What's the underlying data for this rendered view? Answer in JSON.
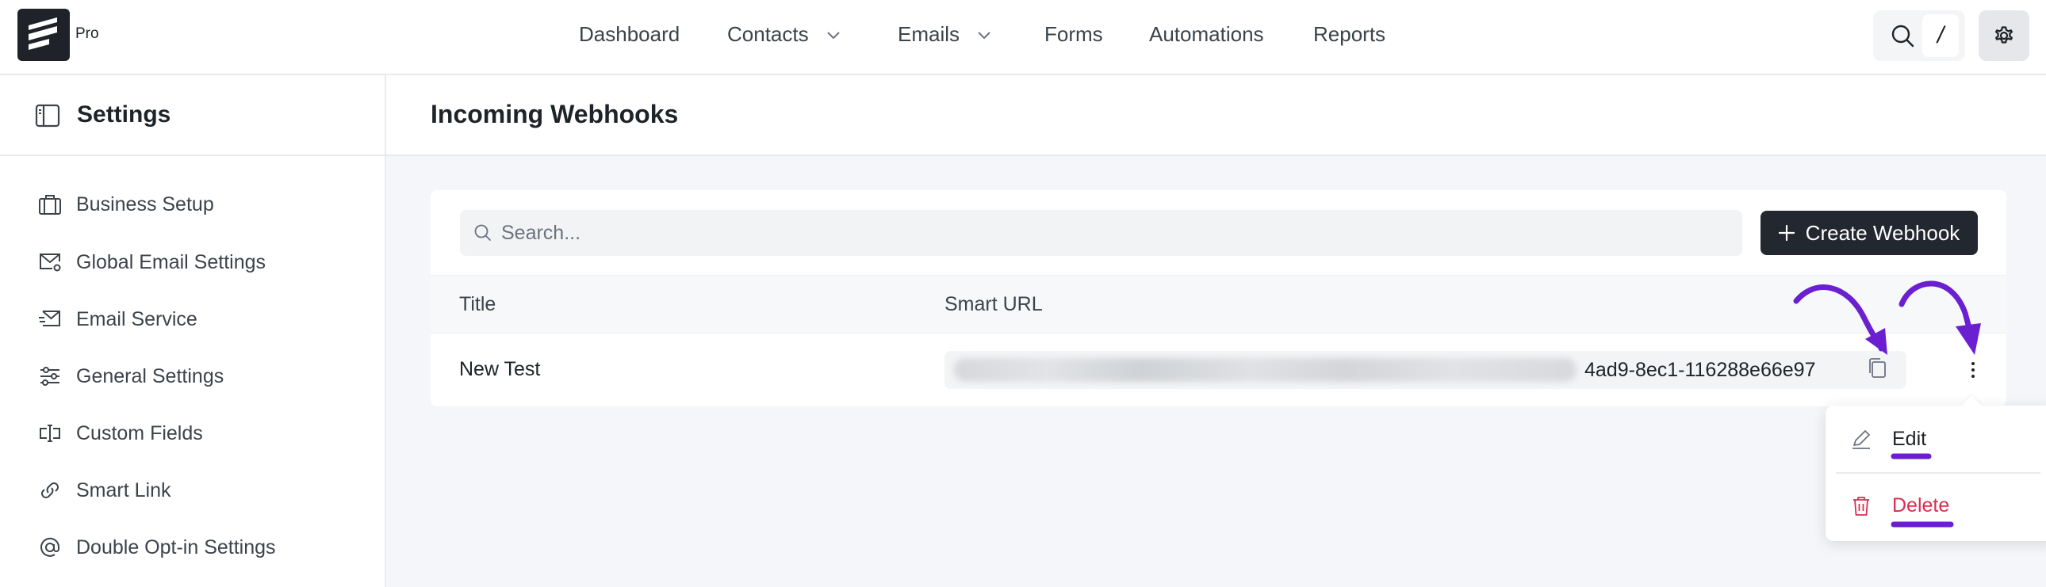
{
  "app": {
    "badge": "Pro"
  },
  "nav": {
    "items": [
      {
        "label": "Dashboard"
      },
      {
        "label": "Contacts"
      },
      {
        "label": "Emails"
      },
      {
        "label": "Forms"
      },
      {
        "label": "Automations"
      },
      {
        "label": "Reports"
      }
    ],
    "shortcut_key": "/"
  },
  "sidebar": {
    "title": "Settings",
    "items": [
      {
        "label": "Business Setup",
        "icon": "briefcase-icon"
      },
      {
        "label": "Global Email Settings",
        "icon": "mail-gear-icon"
      },
      {
        "label": "Email Service",
        "icon": "mail-send-icon"
      },
      {
        "label": "General Settings",
        "icon": "sliders-icon"
      },
      {
        "label": "Custom Fields",
        "icon": "text-field-icon"
      },
      {
        "label": "Smart Link",
        "icon": "link-icon"
      },
      {
        "label": "Double Opt-in Settings",
        "icon": "at-sign-icon"
      }
    ]
  },
  "main": {
    "title": "Incoming Webhooks",
    "search": {
      "placeholder": "Search...",
      "value": ""
    },
    "create_label": "Create Webhook",
    "table": {
      "columns": [
        "Title",
        "Smart URL"
      ],
      "rows": [
        {
          "title": "New Test",
          "url_visible": "4ad9-8ec1-116288e66e97"
        }
      ]
    }
  },
  "menu": {
    "edit_label": "Edit",
    "delete_label": "Delete"
  },
  "colors": {
    "accent_dark": "#232730",
    "danger": "#d6304f",
    "annotation": "#6a1fd0"
  }
}
